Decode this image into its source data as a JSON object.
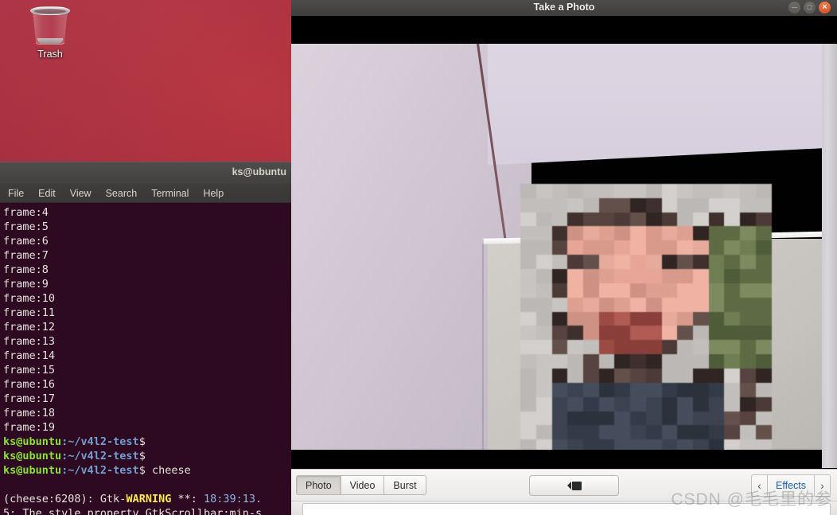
{
  "desktop": {
    "trash": {
      "label": "Trash",
      "icon": "trash-icon"
    },
    "wallpaper_color": "#a42339"
  },
  "terminal": {
    "title": "ks@ubuntu",
    "menu": [
      "File",
      "Edit",
      "View",
      "Search",
      "Terminal",
      "Help"
    ],
    "output_frames": [
      "frame:4",
      "frame:5",
      "frame:6",
      "frame:7",
      "frame:8",
      "frame:9",
      "frame:10",
      "frame:11",
      "frame:12",
      "frame:13",
      "frame:14",
      "frame:15",
      "frame:16",
      "frame:17",
      "frame:18",
      "frame:19"
    ],
    "prompt_user": "ks@ubuntu",
    "prompt_path": ":~/v4l2-test",
    "prompt_symbol": "$",
    "prompt_lines": [
      {
        "user": "ks@ubuntu",
        "path": ":~/v4l2-test",
        "symbol": "$",
        "command": ""
      },
      {
        "user": "ks@ubuntu",
        "path": ":~/v4l2-test",
        "symbol": "$",
        "command": ""
      },
      {
        "user": "ks@ubuntu",
        "path": ":~/v4l2-test",
        "symbol": "$",
        "command": " cheese"
      }
    ],
    "warning": {
      "prefix": "(cheese:6208): Gtk-",
      "level": "WARNING",
      "marker": " **: ",
      "timestamp": "18:39:13.",
      "continuation": "5: The style property GtkScrollbar:min-s"
    }
  },
  "cheese": {
    "title": "Take a Photo",
    "window_controls": {
      "minimize": "minimize-button",
      "maximize": "maximize-button",
      "close": "close-button"
    },
    "mode_tabs": [
      {
        "label": "Photo",
        "active": true
      },
      {
        "label": "Video",
        "active": false
      },
      {
        "label": "Burst",
        "active": false
      }
    ],
    "capture_button": {
      "icon": "camera-capture-icon",
      "label": ""
    },
    "effects": {
      "label": "Effects",
      "prev_icon": "chevron-left-icon",
      "next_icon": "chevron-right-icon"
    },
    "preview": {
      "description": "webcam-live-preview"
    }
  },
  "watermark": {
    "text": "CSDN @毛毛里的参"
  }
}
